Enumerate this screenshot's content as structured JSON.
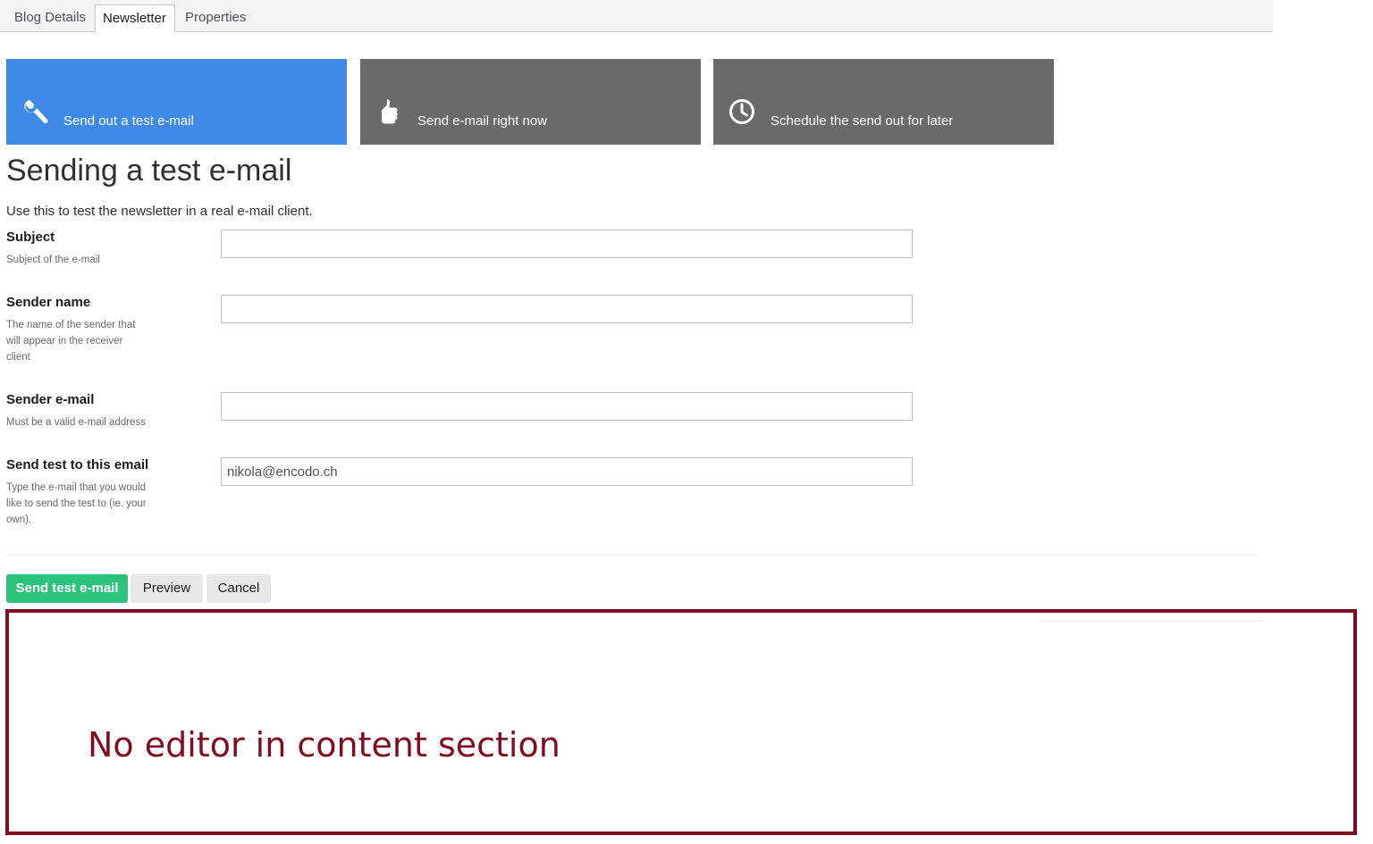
{
  "tabs": [
    "Blog Details",
    "Newsletter",
    "Properties"
  ],
  "actions": [
    {
      "label": "Send out a test e-mail",
      "icon": "wrench-icon"
    },
    {
      "label": "Send e-mail right now",
      "icon": "thumbs-up-icon"
    },
    {
      "label": "Schedule the send out for later",
      "icon": "clock-icon"
    }
  ],
  "colors": {
    "active_tile": "#3e8ae6",
    "inactive_tile": "#6a6a6a",
    "primary_button": "#2bc37c",
    "annotation": "#7f0d1f"
  },
  "page": {
    "title": "Sending a test e-mail",
    "description": "Use this to test the newsletter in a real e-mail client."
  },
  "fields": [
    {
      "label": "Subject",
      "help": "Subject of the e-mail",
      "value": ""
    },
    {
      "label": "Sender name",
      "help": "The name of the sender that will appear in the receiver client",
      "value": ""
    },
    {
      "label": "Sender e-mail",
      "help": "Must be a valid e-mail address",
      "value": ""
    },
    {
      "label": "Send test to this email",
      "help": "Type the e-mail that you would like to send the test to (ie. your own).",
      "value": "nikola@encodo.ch"
    }
  ],
  "buttons": {
    "send": "Send test e-mail",
    "preview": "Preview",
    "cancel": "Cancel"
  },
  "annotation": {
    "text": "No editor in content section"
  }
}
